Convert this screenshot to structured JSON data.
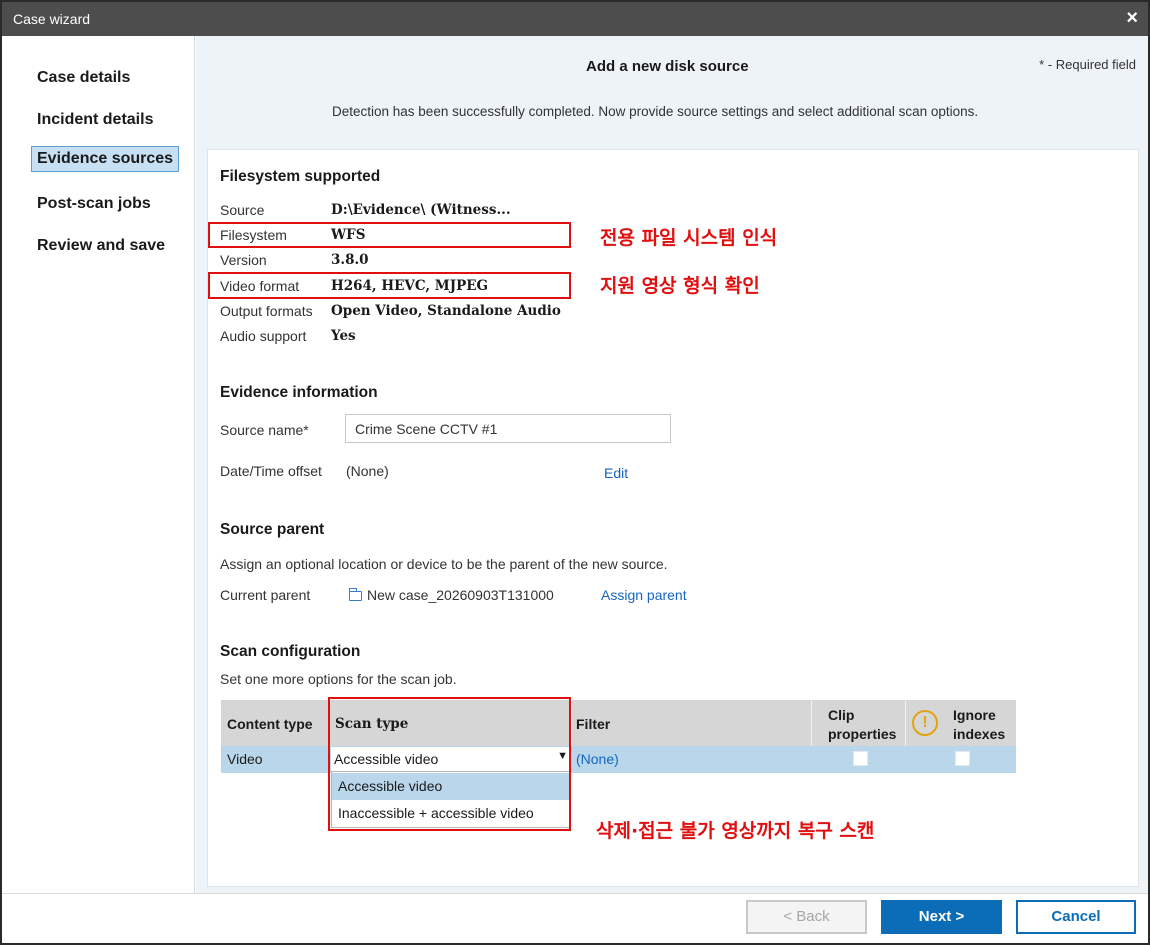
{
  "window": {
    "title": "Case wizard",
    "close_glyph": "×"
  },
  "sidebar": {
    "items": [
      {
        "label": "Case details"
      },
      {
        "label": "Incident details"
      },
      {
        "label": "Evidence sources"
      },
      {
        "label": "Post-scan jobs"
      },
      {
        "label": "Review and save"
      }
    ],
    "active_index": 2
  },
  "header": {
    "title": "Add a new disk source",
    "required_note": "* - Required field",
    "description": "Detection has been successfully completed. Now provide source settings and select additional scan options."
  },
  "filesystem": {
    "heading": "Filesystem supported",
    "rows": [
      {
        "label": "Source",
        "value": "D:\\Evidence\\ (Witness..."
      },
      {
        "label": "Filesystem",
        "value": "WFS"
      },
      {
        "label": "Version",
        "value": "3.8.0"
      },
      {
        "label": "Video format",
        "value": "H264, HEVC, MJPEG"
      },
      {
        "label": "Output formats",
        "value": "Open Video, Standalone Audio"
      },
      {
        "label": "Audio support",
        "value": "Yes"
      }
    ]
  },
  "evidence": {
    "heading": "Evidence information",
    "source_name_label": "Source name*",
    "source_name_value": "Crime Scene CCTV #1",
    "offset_label": "Date/Time offset",
    "offset_value": "(None)",
    "edit_link": "Edit"
  },
  "source_parent": {
    "heading": "Source parent",
    "description": "Assign an optional location or device to be the parent of the new source.",
    "current_label": "Current parent",
    "current_value": "New case_20260903T131000",
    "assign_link": "Assign parent"
  },
  "scan": {
    "heading": "Scan configuration",
    "description": "Set one more options for the scan job.",
    "columns": {
      "content_type": "Content type",
      "scan_type": "Scan type",
      "filter": "Filter",
      "clip_properties_1": "Clip",
      "clip_properties_2": "properties",
      "ignore_indexes_1": "Ignore",
      "ignore_indexes_2": "indexes",
      "warn_glyph": "!"
    },
    "row": {
      "content_type": "Video",
      "scan_type": "Accessible video",
      "filter": "(None)",
      "clip_properties": false,
      "ignore_indexes": false
    },
    "dropdown_arrow": "▼",
    "dropdown_options": [
      "Accessible video",
      "Inaccessible + accessible video"
    ],
    "dropdown_selected": 0
  },
  "annotations": {
    "filesystem_note": "전용 파일 시스템 인식",
    "video_format_note": "지원 영상 형식 확인",
    "scan_type_note": "삭제·접근 불가 영상까지 복구 스캔",
    "color": "#e01010"
  },
  "footer": {
    "back_label": "< Back",
    "next_label": "Next >",
    "cancel_label": "Cancel"
  },
  "colors": {
    "titlebar": "#4d4d4d",
    "accent": "#0b6db7",
    "link": "#1565c0",
    "selection": "#b9d6ea"
  }
}
